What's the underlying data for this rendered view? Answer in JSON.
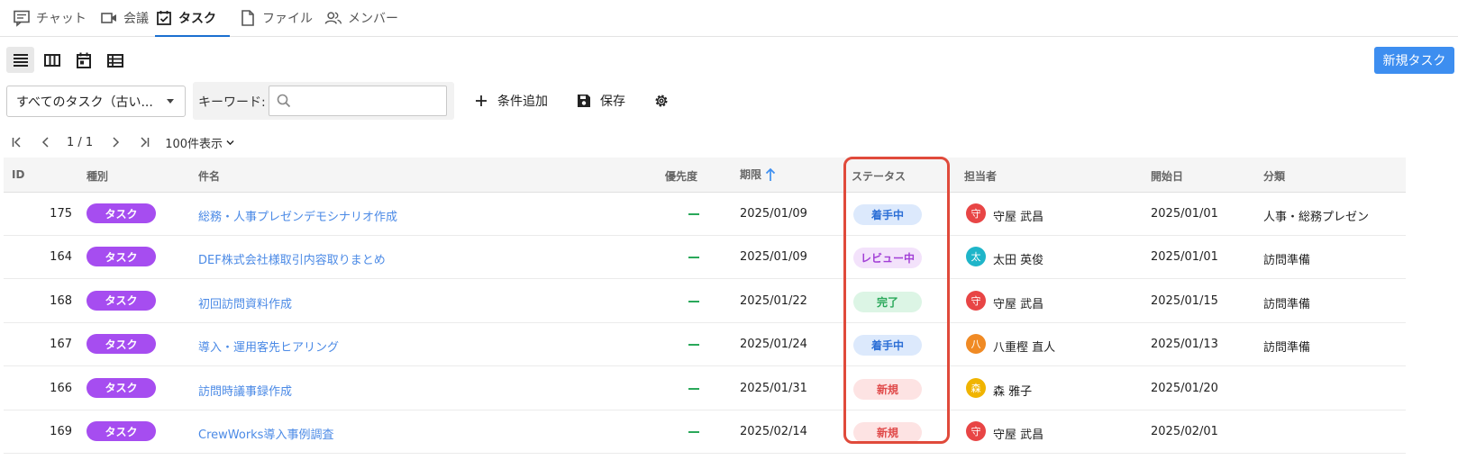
{
  "tabs": [
    {
      "label": "チャット",
      "icon": "chat-icon"
    },
    {
      "label": "会議",
      "icon": "video-icon"
    },
    {
      "label": "タスク",
      "icon": "task-icon",
      "active": true
    },
    {
      "label": "ファイル",
      "icon": "file-icon"
    },
    {
      "label": "メンバー",
      "icon": "members-icon"
    }
  ],
  "toolbar": {
    "new_task_label": "新規タスク",
    "view_modes": [
      "list-view-icon",
      "board-view-icon",
      "calendar-view-icon",
      "table-view-icon"
    ]
  },
  "filter": {
    "select_value": "すべてのタスク（古い...",
    "keyword_label": "キーワード:",
    "keyword_placeholder": "",
    "add_condition_label": "条件追加",
    "save_label": "保存"
  },
  "pager": {
    "page_text": "1 / 1",
    "per_page_label": "100件表示"
  },
  "table": {
    "headers": {
      "id": "ID",
      "type": "種別",
      "title": "件名",
      "priority": "優先度",
      "due": "期限",
      "status": "ステータス",
      "assignee": "担当者",
      "start": "開始日",
      "category": "分類"
    },
    "rows": [
      {
        "id": "175",
        "type": "タスク",
        "title": "総務・人事プレゼンデモシナリオ作成",
        "priority": "—",
        "due": "2025/01/09",
        "status": "着手中",
        "avatar": "守",
        "assignee": "守屋 武昌",
        "start": "2025/01/01",
        "category": "人事・総務プレゼン"
      },
      {
        "id": "164",
        "type": "タスク",
        "title": "DEF株式会社様取引内容取りまとめ",
        "priority": "—",
        "due": "2025/01/09",
        "status": "レビュー中",
        "avatar": "太",
        "assignee": "太田 英俊",
        "start": "2025/01/01",
        "category": "訪問準備"
      },
      {
        "id": "168",
        "type": "タスク",
        "title": "初回訪問資料作成",
        "priority": "—",
        "due": "2025/01/22",
        "status": "完了",
        "avatar": "守",
        "assignee": "守屋 武昌",
        "start": "2025/01/15",
        "category": "訪問準備"
      },
      {
        "id": "167",
        "type": "タスク",
        "title": "導入・運用客先ヒアリング",
        "priority": "—",
        "due": "2025/01/24",
        "status": "着手中",
        "avatar": "八",
        "assignee": "八重樫 直人",
        "start": "2025/01/13",
        "category": "訪問準備"
      },
      {
        "id": "166",
        "type": "タスク",
        "title": "訪問時議事録作成",
        "priority": "—",
        "due": "2025/01/31",
        "status": "新規",
        "avatar": "森",
        "assignee": "森 雅子",
        "start": "2025/01/20",
        "category": ""
      },
      {
        "id": "169",
        "type": "タスク",
        "title": "CrewWorks導入事例調査",
        "priority": "—",
        "due": "2025/02/14",
        "status": "新規",
        "avatar": "守",
        "assignee": "守屋 武昌",
        "start": "2025/02/01",
        "category": ""
      }
    ]
  },
  "colors": {
    "accent": "#1b6fd0",
    "primary_button": "#3d8ef0",
    "type_badge": "#a64df0",
    "link": "#4b8ae6",
    "priority_dash": "#2aa85a",
    "highlight": "#e04a3b",
    "status": {
      "着手中": {
        "bg": "#dce9fc",
        "fg": "#2c6fd6"
      },
      "レビュー中": {
        "bg": "#f3e2fb",
        "fg": "#a23fd6"
      },
      "完了": {
        "bg": "#dcf5e5",
        "fg": "#2aa85a"
      },
      "新規": {
        "bg": "#fde3e3",
        "fg": "#e04a4a"
      }
    },
    "avatar": {
      "守": "#e84545",
      "太": "#1fb5c9",
      "八": "#f08a24",
      "森": "#f0b400"
    }
  }
}
